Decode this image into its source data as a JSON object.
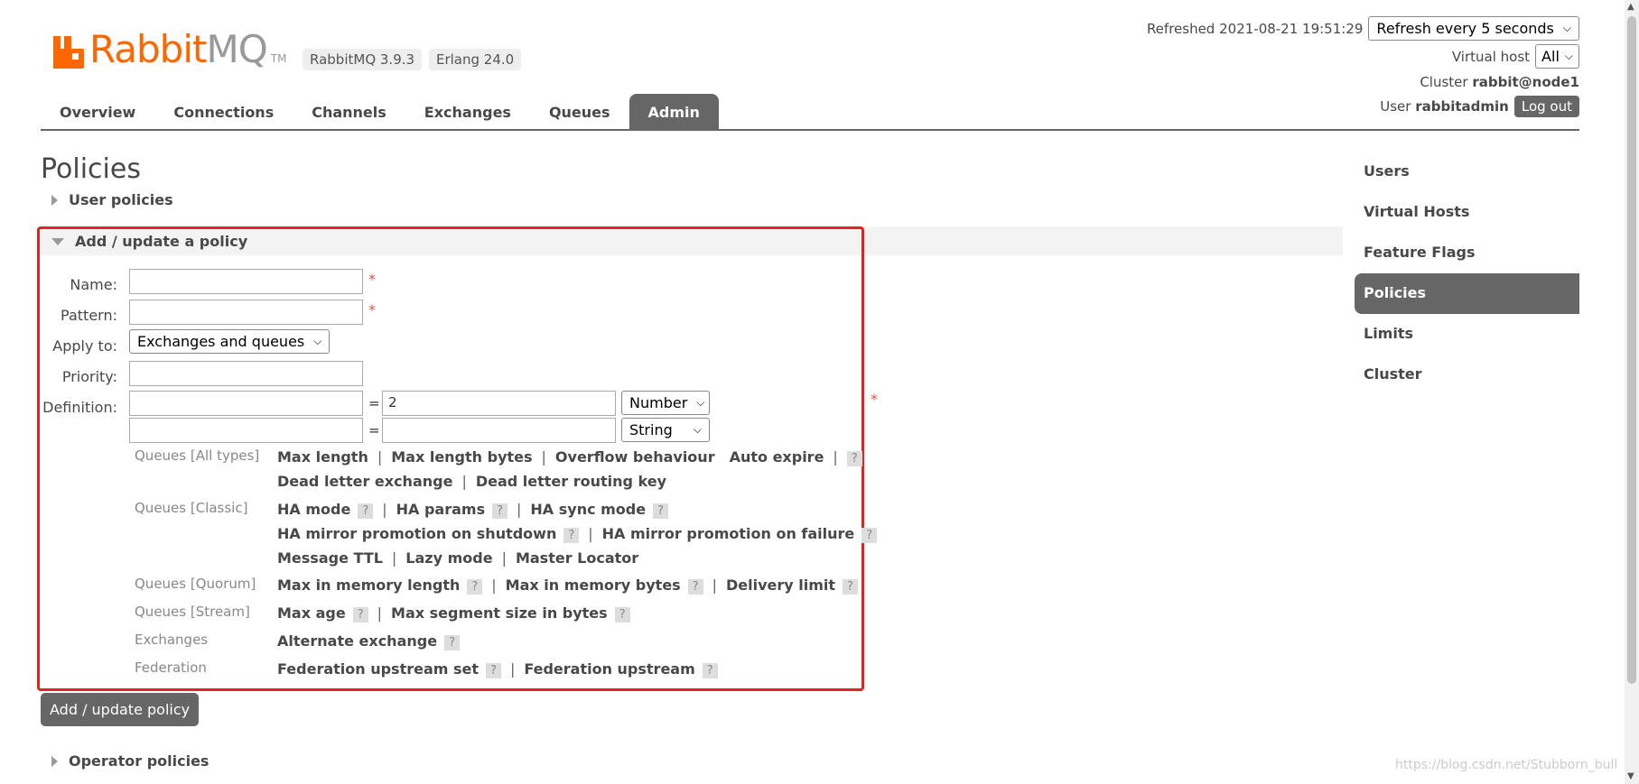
{
  "header": {
    "logo_text_a": "Rabbit",
    "logo_text_b": "MQ",
    "logo_tm": "TM",
    "version_badge": "RabbitMQ 3.9.3",
    "erlang_badge": "Erlang 24.0",
    "refreshed_label": "Refreshed 2021-08-21 19:51:29",
    "refresh_select": "Refresh every 5 seconds",
    "vhost_label": "Virtual host",
    "vhost_select": "All",
    "cluster_label": "Cluster",
    "cluster_value": "rabbit@node1",
    "user_label": "User",
    "user_value": "rabbitadmin",
    "logout_label": "Log out"
  },
  "tabs": [
    {
      "label": "Overview"
    },
    {
      "label": "Connections"
    },
    {
      "label": "Channels"
    },
    {
      "label": "Exchanges"
    },
    {
      "label": "Queues"
    },
    {
      "label": "Admin"
    }
  ],
  "active_tab": "Admin",
  "rightnav": [
    {
      "label": "Users"
    },
    {
      "label": "Virtual Hosts"
    },
    {
      "label": "Feature Flags"
    },
    {
      "label": "Policies"
    },
    {
      "label": "Limits"
    },
    {
      "label": "Cluster"
    }
  ],
  "page_title": "Policies",
  "sections": {
    "user_policies": "User policies",
    "add_update": "Add / update a policy",
    "operator_policies": "Operator policies"
  },
  "form": {
    "name_label": "Name:",
    "name_value": "",
    "pattern_label": "Pattern:",
    "pattern_value": "",
    "apply_label": "Apply to:",
    "apply_value": "Exchanges and queues",
    "priority_label": "Priority:",
    "priority_value": "",
    "definition_label": "Definition:",
    "def_rows": [
      {
        "key": "",
        "value": "2",
        "type": "Number"
      },
      {
        "key": "",
        "value": "",
        "type": "String"
      }
    ],
    "required_mark": "*",
    "equals": "="
  },
  "option_groups": {
    "queues_all": {
      "label": "Queues [All types]",
      "line1": [
        "Max length",
        "Max length bytes",
        "Overflow behaviour",
        "Auto expire"
      ],
      "line2": [
        "Dead letter exchange",
        "Dead letter routing key"
      ]
    },
    "queues_classic": {
      "label": "Queues [Classic]",
      "line1": [
        "HA mode",
        "HA params",
        "HA sync mode"
      ],
      "line2": [
        "HA mirror promotion on shutdown",
        "HA mirror promotion on failure"
      ],
      "line3": [
        "Message TTL",
        "Lazy mode",
        "Master Locator"
      ]
    },
    "queues_quorum": {
      "label": "Queues [Quorum]",
      "line1": [
        "Max in memory length",
        "Max in memory bytes",
        "Delivery limit"
      ]
    },
    "queues_stream": {
      "label": "Queues [Stream]",
      "line1": [
        "Max age",
        "Max segment size in bytes"
      ]
    },
    "exchanges": {
      "label": "Exchanges",
      "line1": [
        "Alternate exchange"
      ]
    },
    "federation": {
      "label": "Federation",
      "line1": [
        "Federation upstream set",
        "Federation upstream"
      ]
    }
  },
  "help_mark": "?",
  "separator": "|",
  "submit_label": "Add / update policy",
  "watermark": "https://blog.csdn.net/Stubborn_bull",
  "colors": {
    "brand_orange": "#ff6600",
    "nav_active": "#666666",
    "highlight_red": "#e52222"
  }
}
